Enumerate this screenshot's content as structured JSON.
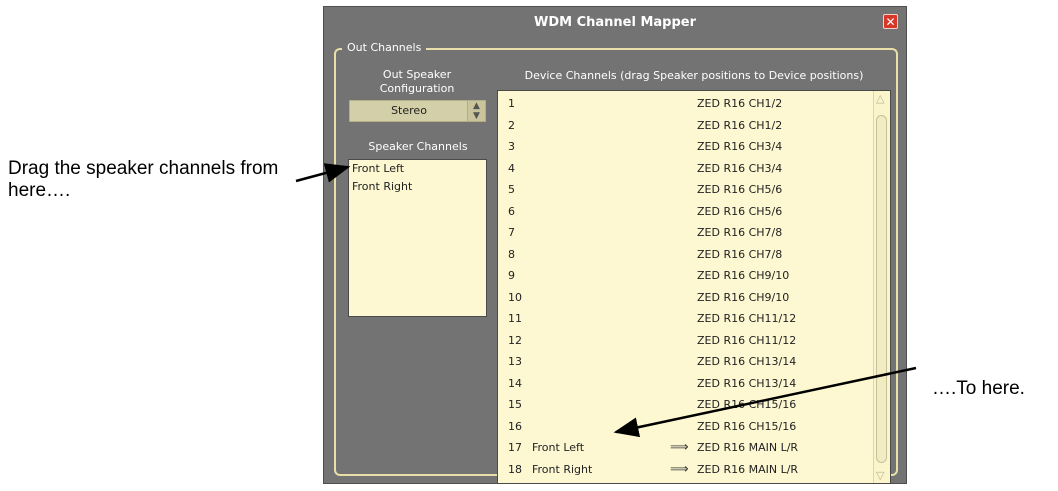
{
  "annotations": {
    "left": "Drag the speaker channels from here….",
    "right": "….To here."
  },
  "window": {
    "title": "WDM Channel Mapper",
    "close_label": "✕"
  },
  "out_channels": {
    "group_label": "Out Channels",
    "speaker_config_label": "Out Speaker Configuration",
    "speaker_config_value": "Stereo",
    "speaker_channels_label": "Speaker Channels",
    "speaker_channels": [
      "Front Left",
      "Front Right"
    ],
    "device_channels_label": "Device Channels (drag Speaker positions to Device positions)",
    "device_rows": [
      {
        "num": "1",
        "speaker": "",
        "device": "ZED R16 CH1/2",
        "mapped": false
      },
      {
        "num": "2",
        "speaker": "",
        "device": "ZED R16 CH1/2",
        "mapped": false
      },
      {
        "num": "3",
        "speaker": "",
        "device": "ZED R16 CH3/4",
        "mapped": false
      },
      {
        "num": "4",
        "speaker": "",
        "device": "ZED R16 CH3/4",
        "mapped": false
      },
      {
        "num": "5",
        "speaker": "",
        "device": "ZED R16 CH5/6",
        "mapped": false
      },
      {
        "num": "6",
        "speaker": "",
        "device": "ZED R16 CH5/6",
        "mapped": false
      },
      {
        "num": "7",
        "speaker": "",
        "device": "ZED R16 CH7/8",
        "mapped": false
      },
      {
        "num": "8",
        "speaker": "",
        "device": "ZED R16 CH7/8",
        "mapped": false
      },
      {
        "num": "9",
        "speaker": "",
        "device": "ZED R16 CH9/10",
        "mapped": false
      },
      {
        "num": "10",
        "speaker": "",
        "device": "ZED R16 CH9/10",
        "mapped": false
      },
      {
        "num": "11",
        "speaker": "",
        "device": "ZED R16 CH11/12",
        "mapped": false
      },
      {
        "num": "12",
        "speaker": "",
        "device": "ZED R16 CH11/12",
        "mapped": false
      },
      {
        "num": "13",
        "speaker": "",
        "device": "ZED R16 CH13/14",
        "mapped": false
      },
      {
        "num": "14",
        "speaker": "",
        "device": "ZED R16 CH13/14",
        "mapped": false
      },
      {
        "num": "15",
        "speaker": "",
        "device": "ZED R16 CH15/16",
        "mapped": false
      },
      {
        "num": "16",
        "speaker": "",
        "device": "ZED R16 CH15/16",
        "mapped": false
      },
      {
        "num": "17",
        "speaker": "Front Left",
        "device": "ZED R16 MAIN L/R",
        "mapped": true
      },
      {
        "num": "18",
        "speaker": "Front Right",
        "device": "ZED R16 MAIN L/R",
        "mapped": true
      }
    ]
  },
  "colors": {
    "window_bg": "#737373",
    "list_bg": "#fdf8d2",
    "group_border": "#e9dfa8",
    "close_button": "#d8382a"
  }
}
